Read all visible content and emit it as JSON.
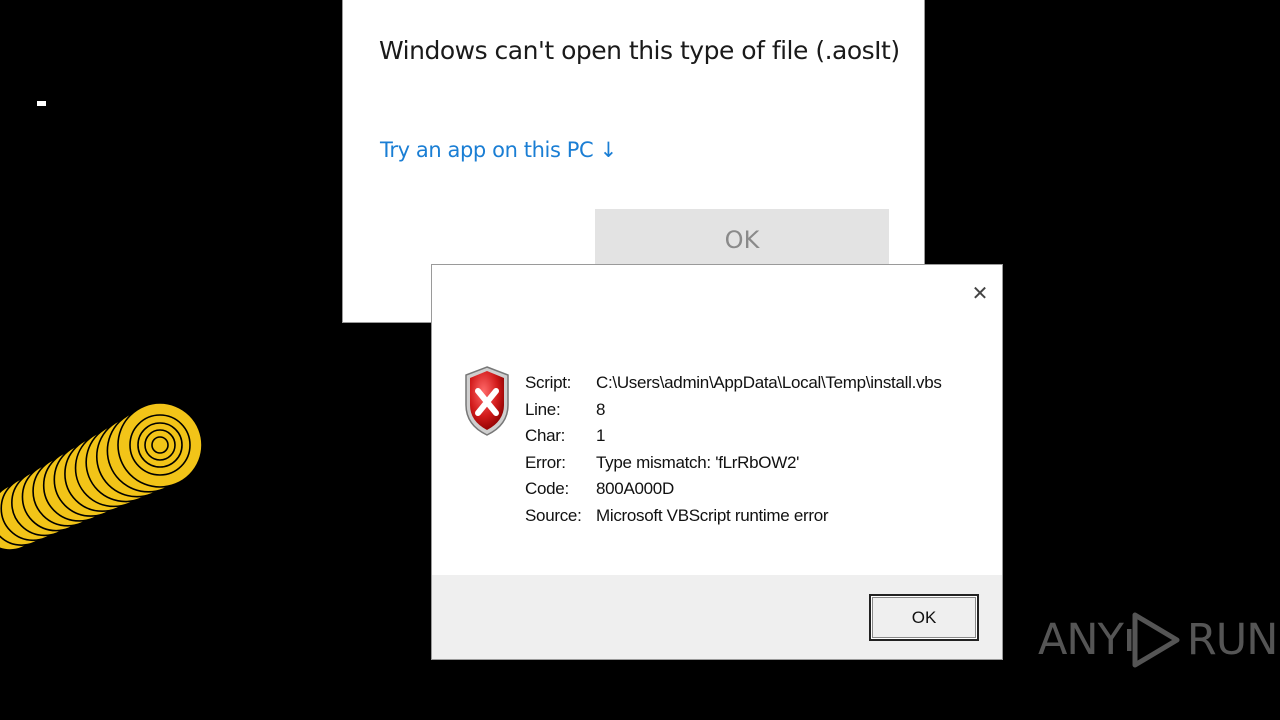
{
  "open_with_dialog": {
    "title": "Windows can't open this type of file (.aosIt)",
    "link": "Try an app on this PC ↓",
    "ok_label": "OK"
  },
  "error_dialog": {
    "close_glyph": "✕",
    "icon": "error-x-icon",
    "rows": [
      {
        "label": "Script:",
        "value": "C:\\Users\\admin\\AppData\\Local\\Temp\\install.vbs"
      },
      {
        "label": "Line:",
        "value": "8"
      },
      {
        "label": "Char:",
        "value": "1"
      },
      {
        "label": "Error:",
        "value": "Type mismatch: 'fLrRbOW2'"
      },
      {
        "label": "Code:",
        "value": "800A000D"
      },
      {
        "label": "Source:",
        "value": "Microsoft VBScript runtime error"
      }
    ],
    "ok_label": "OK"
  },
  "watermark": {
    "left": "ANY",
    "right": "RUN"
  },
  "colors": {
    "background": "#000000",
    "link": "#1a7ed4",
    "swirl": "#f2c418"
  }
}
